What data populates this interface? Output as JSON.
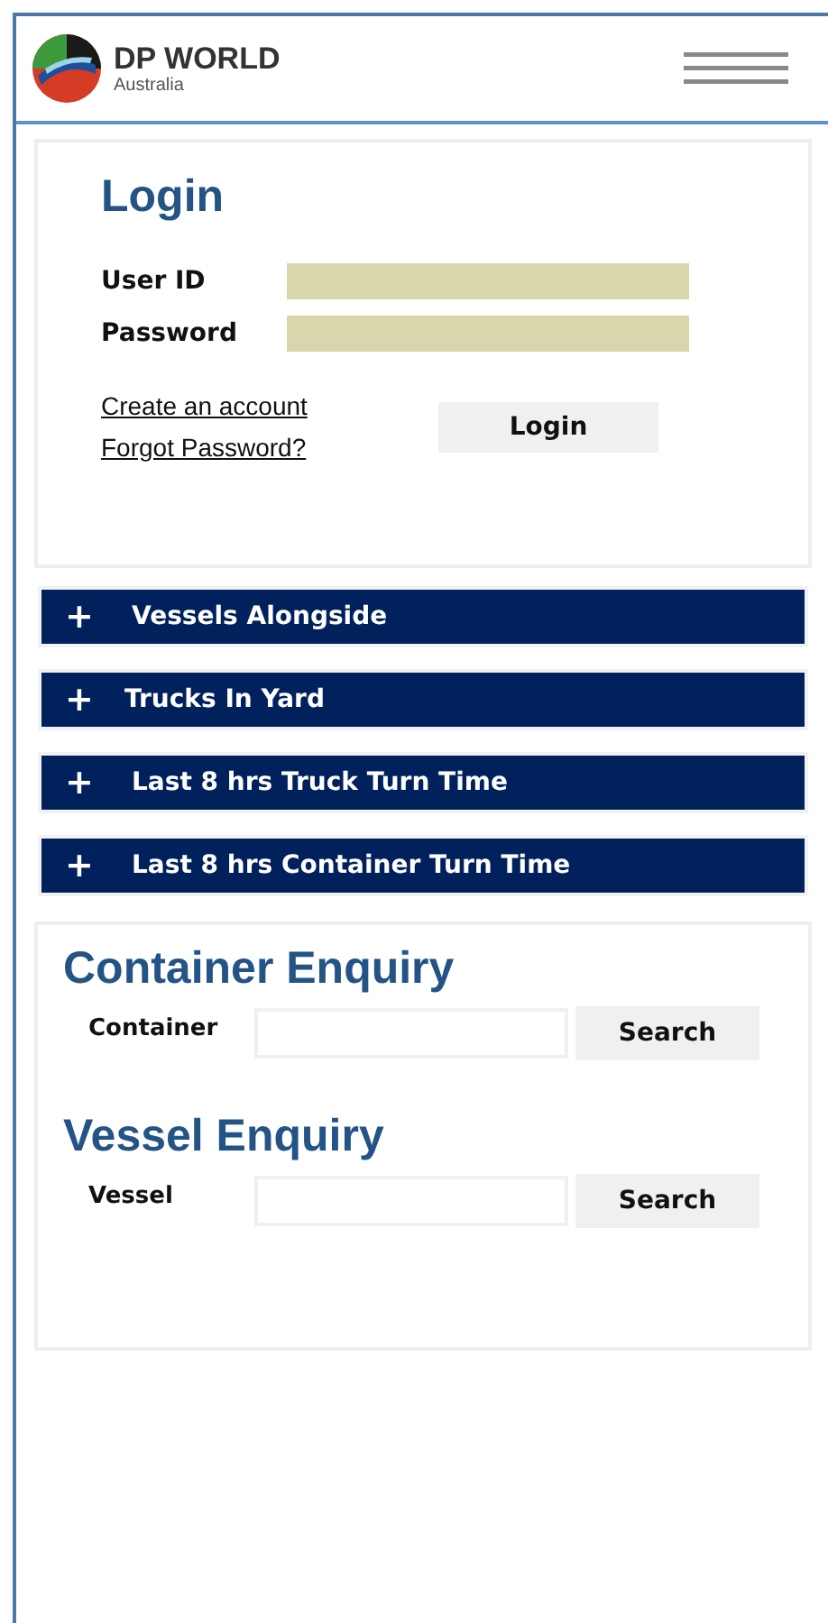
{
  "header": {
    "brand": "DP WORLD",
    "subbrand": "Australia"
  },
  "login": {
    "title": "Login",
    "fields": [
      {
        "label": "User ID"
      },
      {
        "label": "Password"
      }
    ],
    "links": [
      "Create an account",
      "Forgot Password?"
    ],
    "button": "Login"
  },
  "accordion": [
    {
      "icon": "+",
      "label": "Vessels Alongside"
    },
    {
      "icon": "+",
      "label": "Trucks In Yard"
    },
    {
      "icon": "+",
      "label": "Last 8 hrs Truck Turn Time"
    },
    {
      "icon": "+",
      "label": "Last 8 hrs Container Turn Time"
    }
  ],
  "enquiries": [
    {
      "title": "Container Enquiry",
      "label": "Container",
      "button": "Search"
    },
    {
      "title": "Vessel Enquiry",
      "label": "Vessel",
      "button": "Search"
    }
  ]
}
